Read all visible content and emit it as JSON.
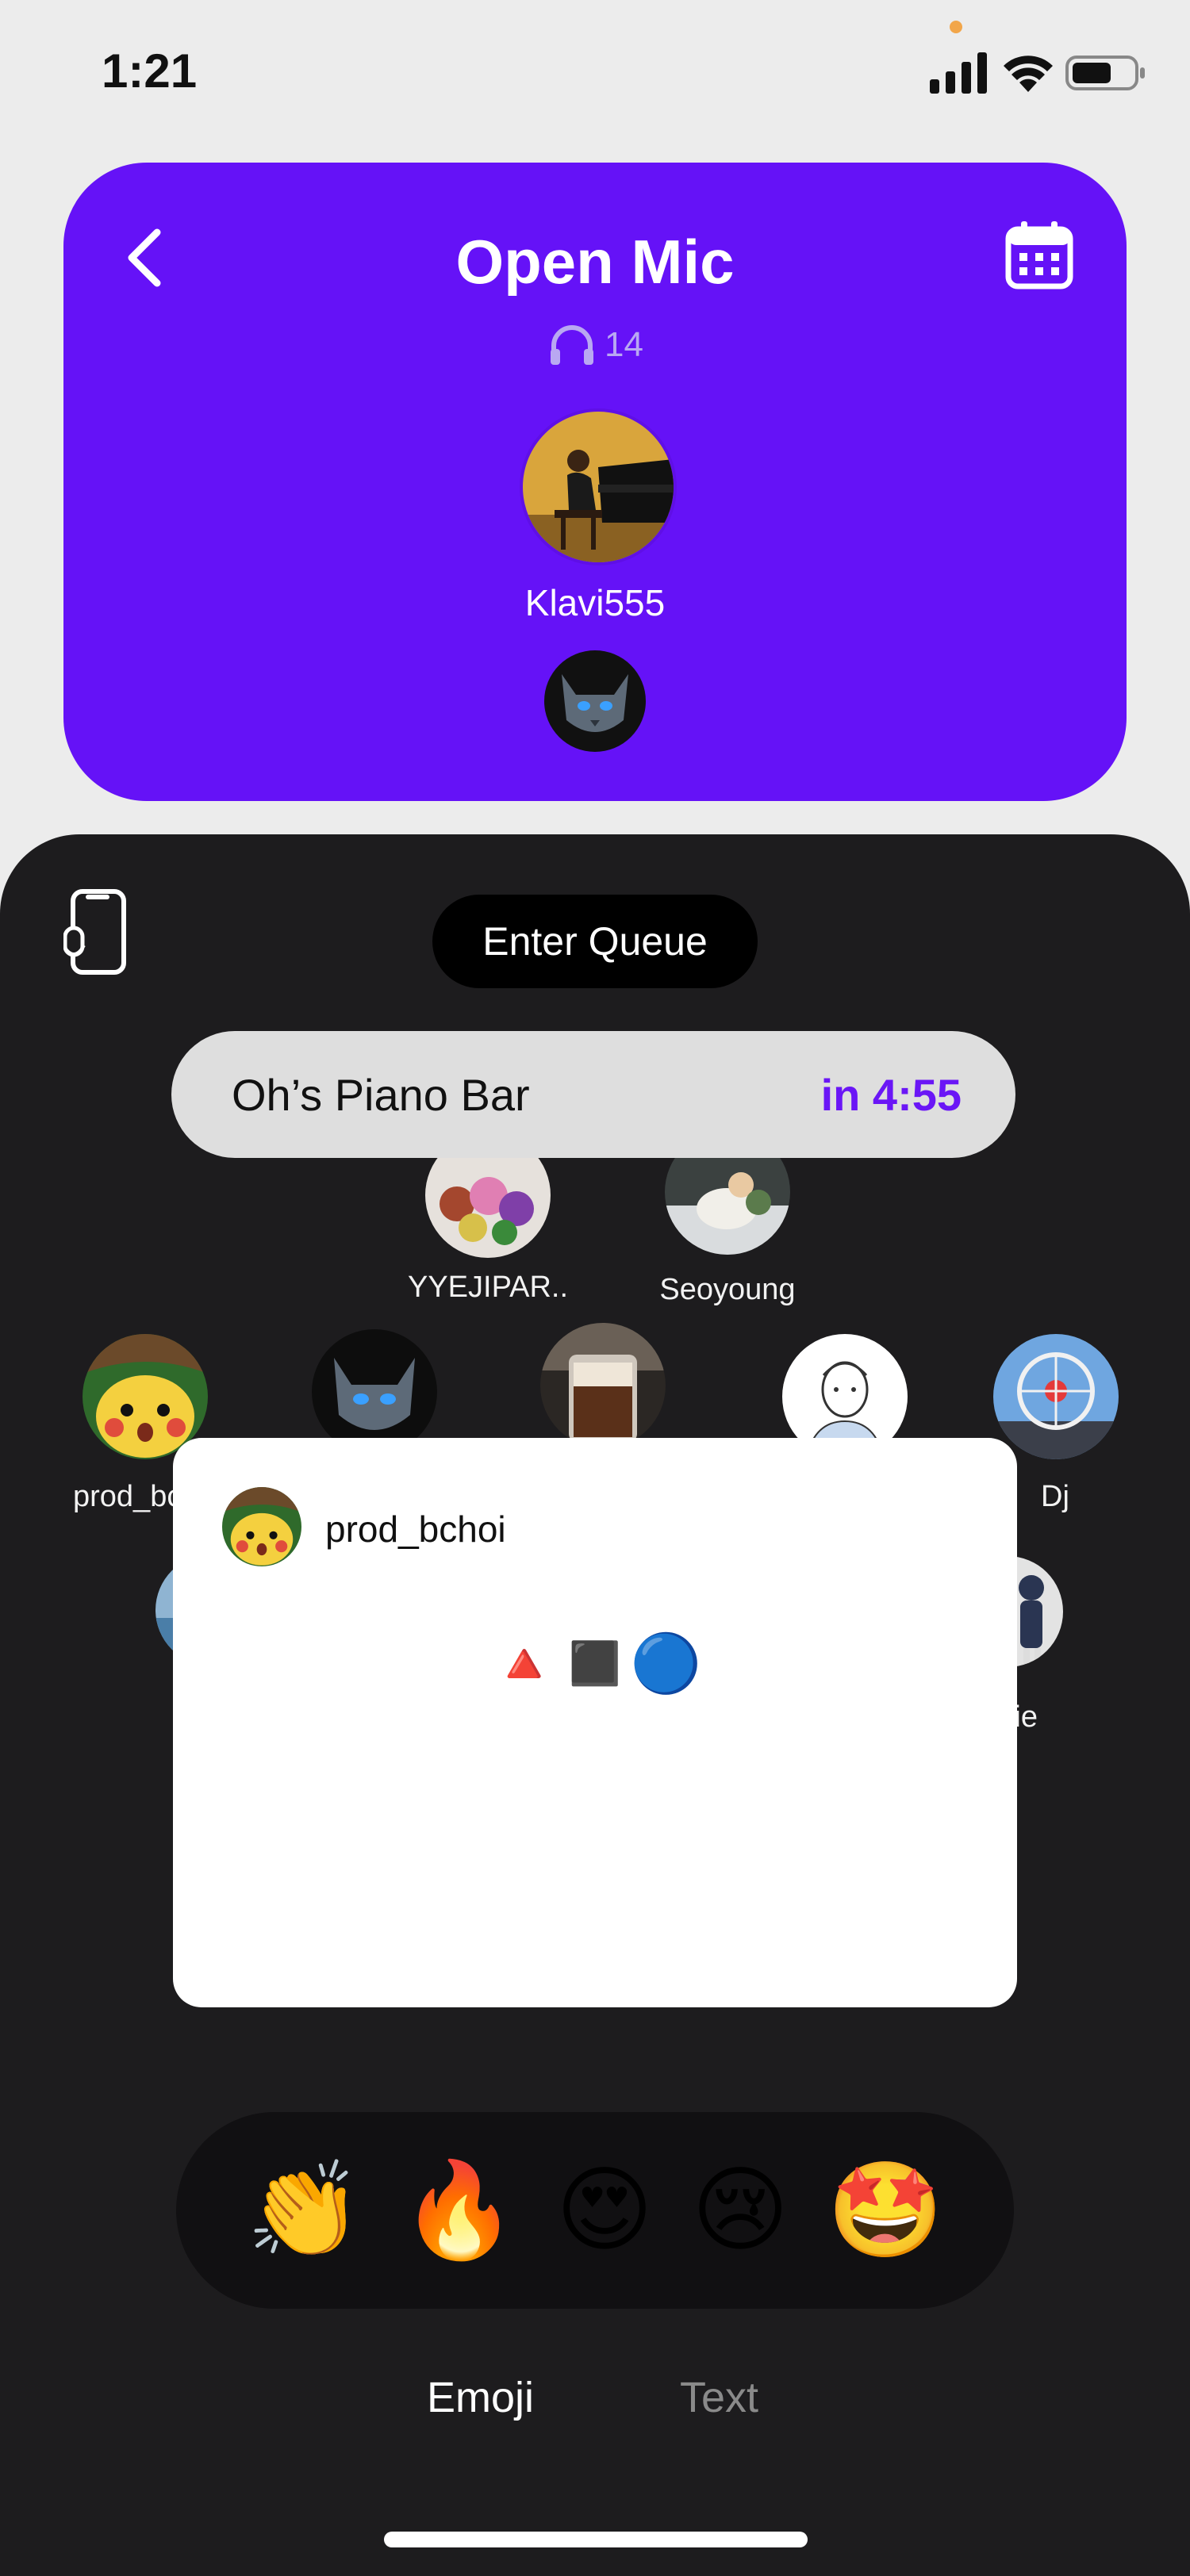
{
  "status_bar": {
    "time": "1:21"
  },
  "header": {
    "title": "Open Mic",
    "listener_count": "14",
    "host_name": "Klavi555"
  },
  "controls": {
    "enter_queue_label": "Enter Queue"
  },
  "queue": {
    "name": "Oh’s Piano Bar",
    "timer": "in 4:55"
  },
  "audience": [
    {
      "name": "YYEJIPAR.."
    },
    {
      "name": "Seoyoung"
    },
    {
      "name": "prod_bc"
    },
    {
      "name": ""
    },
    {
      "name": ""
    },
    {
      "name": ""
    },
    {
      "name": "Dj"
    },
    {
      "name": "ie"
    }
  ],
  "message": {
    "user": "prod_bchoi",
    "body": "🔺◼️🔵"
  },
  "reactions": [
    "👏",
    "🔥",
    "😍",
    "😢",
    "🤩"
  ],
  "tabs": {
    "emoji": "Emoji",
    "text": "Text"
  },
  "colors": {
    "accent": "#6512f7",
    "panel": "#1d1c1e",
    "timer": "#6a16f6"
  }
}
